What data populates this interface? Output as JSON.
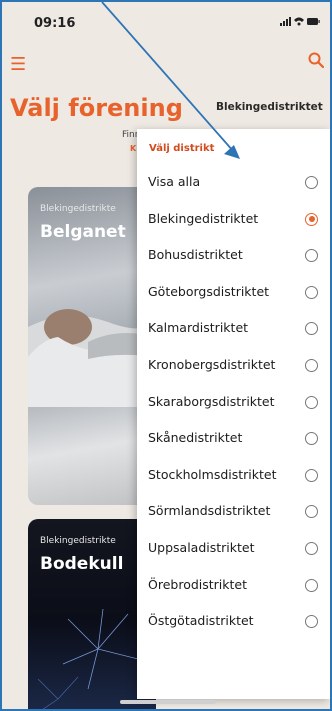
{
  "status": {
    "time": "09:16",
    "icons": "••• ▿ ▬"
  },
  "header": {
    "title": "Välj förening",
    "district_selected": "Blekingedistriktet",
    "subtitle_1": "Finns",
    "subtitle_2": "K"
  },
  "cards": [
    {
      "district": "Blekingedistrikte",
      "name": "Belganet"
    },
    {
      "district": "Blekingedistrikte",
      "name": "Bodekull"
    }
  ],
  "dropdown": {
    "heading": "Välj distrikt",
    "options": [
      {
        "label": "Visa alla",
        "selected": false
      },
      {
        "label": "Blekingedistriktet",
        "selected": true
      },
      {
        "label": "Bohusdistriktet",
        "selected": false
      },
      {
        "label": "Göteborgsdistriktet",
        "selected": false
      },
      {
        "label": "Kalmardistriktet",
        "selected": false
      },
      {
        "label": "Kronobergsdistriktet",
        "selected": false
      },
      {
        "label": "Skaraborgsdistriktet",
        "selected": false
      },
      {
        "label": "Skånedistriktet",
        "selected": false
      },
      {
        "label": "Stockholmsdistriktet",
        "selected": false
      },
      {
        "label": "Sörmlandsdistriktet",
        "selected": false
      },
      {
        "label": "Uppsaladistriktet",
        "selected": false
      },
      {
        "label": "Örebrodistriktet",
        "selected": false
      },
      {
        "label": "Östgötadistriktet",
        "selected": false
      }
    ]
  },
  "colors": {
    "accent": "#e8622c",
    "annotation_arrow": "#2e75b6"
  }
}
